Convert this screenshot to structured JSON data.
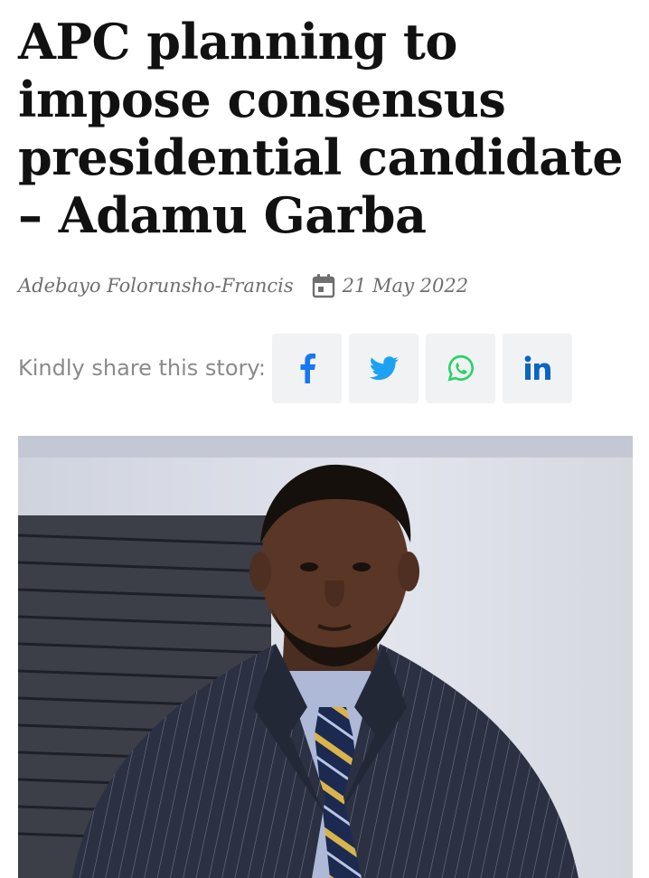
{
  "article": {
    "title": "APC planning to impose consensus presidential candidate – Adamu Garba",
    "author": "Adebayo Folorunsho-Francis",
    "date": "21 May 2022",
    "date_icon": "calendar-icon"
  },
  "share": {
    "label": "Kindly share this story:",
    "buttons": [
      {
        "network": "facebook",
        "icon": "facebook-icon",
        "color": "#1877f2"
      },
      {
        "network": "twitter",
        "icon": "twitter-icon",
        "color": "#1da1f2"
      },
      {
        "network": "whatsapp",
        "icon": "whatsapp-icon",
        "color": "#25d366"
      },
      {
        "network": "linkedin",
        "icon": "linkedin-icon",
        "color": "#0a66c2"
      }
    ]
  },
  "featured_image": {
    "subject": "portrait of a man in a pinstriped suit and striped tie"
  },
  "colors": {
    "headline": "#111111",
    "meta": "#6f6f6f",
    "share_label": "#8a8a8a",
    "share_button_bg": "#f1f2f4"
  }
}
